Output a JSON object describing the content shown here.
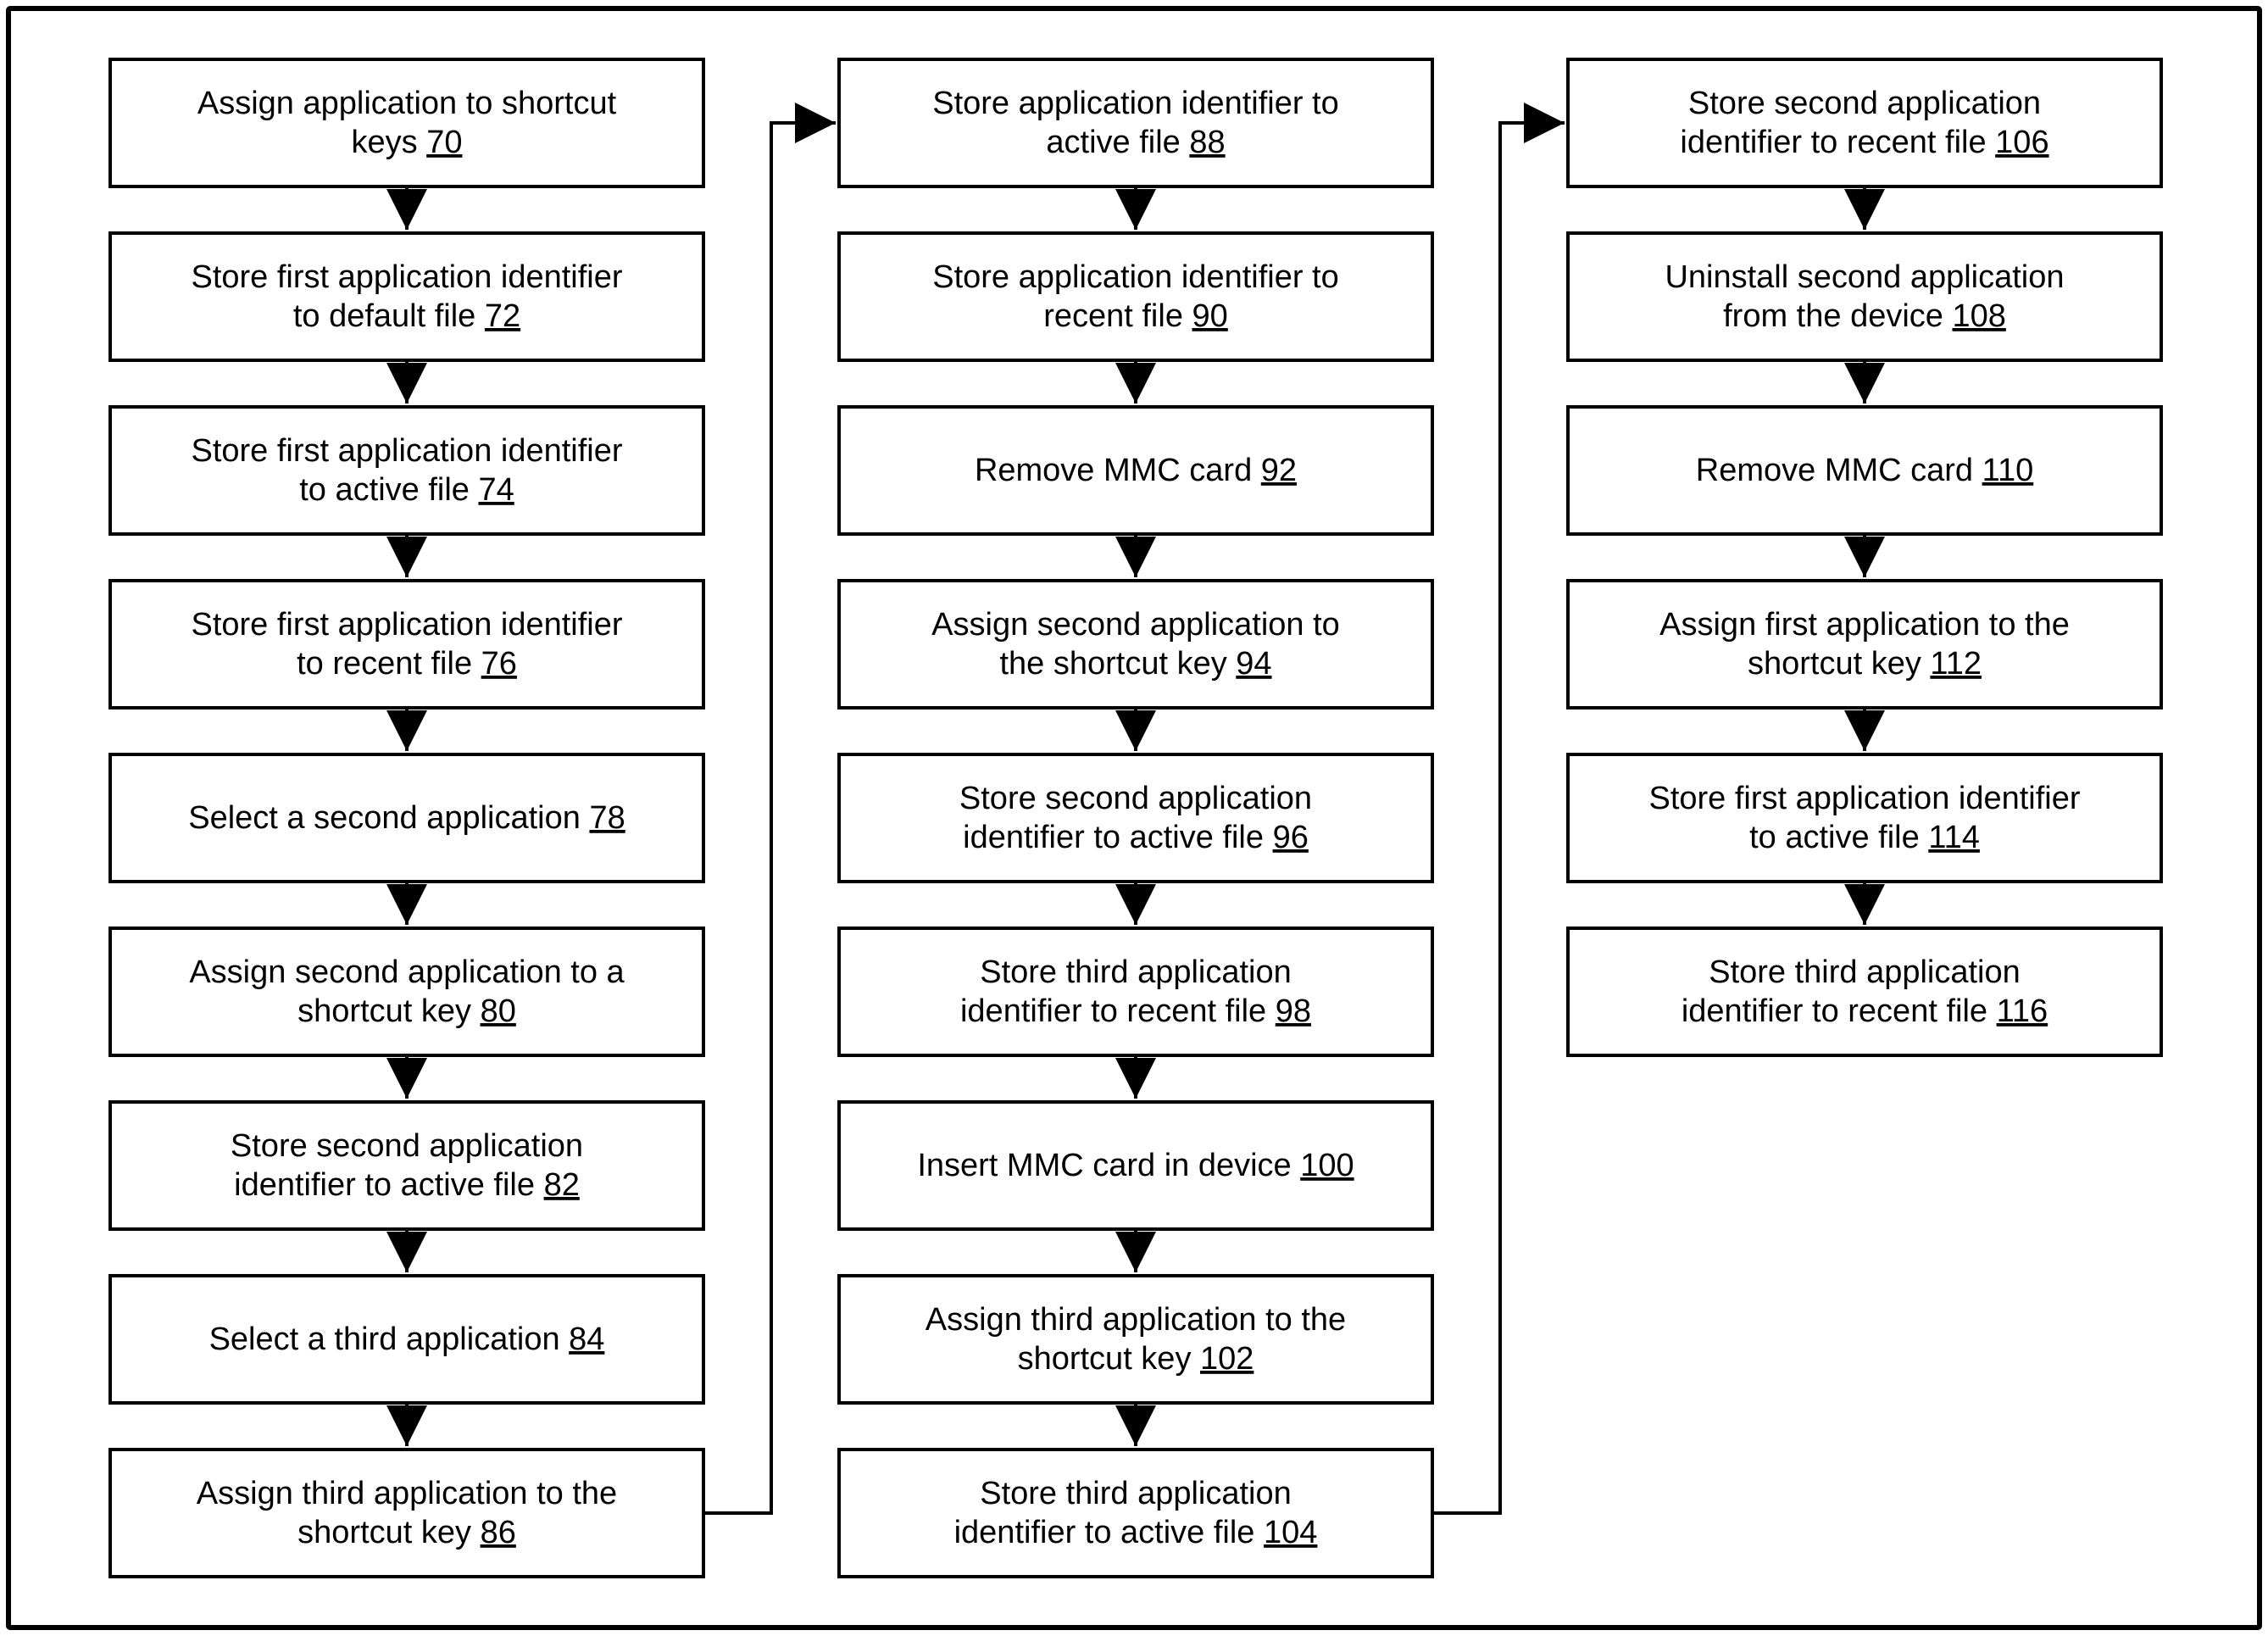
{
  "columns": [
    {
      "id": "col1",
      "steps": [
        {
          "ref": "70",
          "lines": [
            "Assign application to shortcut",
            "keys"
          ]
        },
        {
          "ref": "72",
          "lines": [
            "Store first application identifier",
            "to default file"
          ]
        },
        {
          "ref": "74",
          "lines": [
            "Store first application identifier",
            "to active file"
          ]
        },
        {
          "ref": "76",
          "lines": [
            "Store first application identifier",
            "to recent file"
          ]
        },
        {
          "ref": "78",
          "lines": [
            "Select a second application"
          ]
        },
        {
          "ref": "80",
          "lines": [
            "Assign second application to a",
            "shortcut key"
          ]
        },
        {
          "ref": "82",
          "lines": [
            "Store second application",
            "identifier to active file"
          ]
        },
        {
          "ref": "84",
          "lines": [
            "Select a third application"
          ]
        },
        {
          "ref": "86",
          "lines": [
            "Assign third application to the",
            "shortcut key"
          ]
        }
      ]
    },
    {
      "id": "col2",
      "steps": [
        {
          "ref": "88",
          "lines": [
            "Store application identifier to",
            "active file"
          ]
        },
        {
          "ref": "90",
          "lines": [
            "Store application identifier to",
            "recent file"
          ]
        },
        {
          "ref": "92",
          "lines": [
            "Remove MMC card"
          ]
        },
        {
          "ref": "94",
          "lines": [
            "Assign second application to",
            "the shortcut key"
          ]
        },
        {
          "ref": "96",
          "lines": [
            "Store second application",
            "identifier to active file"
          ]
        },
        {
          "ref": "98",
          "lines": [
            "Store third application",
            "identifier to recent file"
          ]
        },
        {
          "ref": "100",
          "lines": [
            "Insert MMC card in device"
          ]
        },
        {
          "ref": "102",
          "lines": [
            "Assign third application to the",
            "shortcut key"
          ]
        },
        {
          "ref": "104",
          "lines": [
            "Store third application",
            "identifier to active file"
          ]
        }
      ]
    },
    {
      "id": "col3",
      "steps": [
        {
          "ref": "106",
          "lines": [
            "Store second application",
            "identifier to recent file"
          ]
        },
        {
          "ref": "108",
          "lines": [
            "Uninstall second application",
            "from the device"
          ]
        },
        {
          "ref": "110",
          "lines": [
            "Remove MMC card"
          ]
        },
        {
          "ref": "112",
          "lines": [
            "Assign first application to the",
            "shortcut key"
          ]
        },
        {
          "ref": "114",
          "lines": [
            "Store first application identifier",
            "to active file"
          ]
        },
        {
          "ref": "116",
          "lines": [
            "Store third application",
            "identifier to recent file"
          ]
        }
      ]
    }
  ]
}
